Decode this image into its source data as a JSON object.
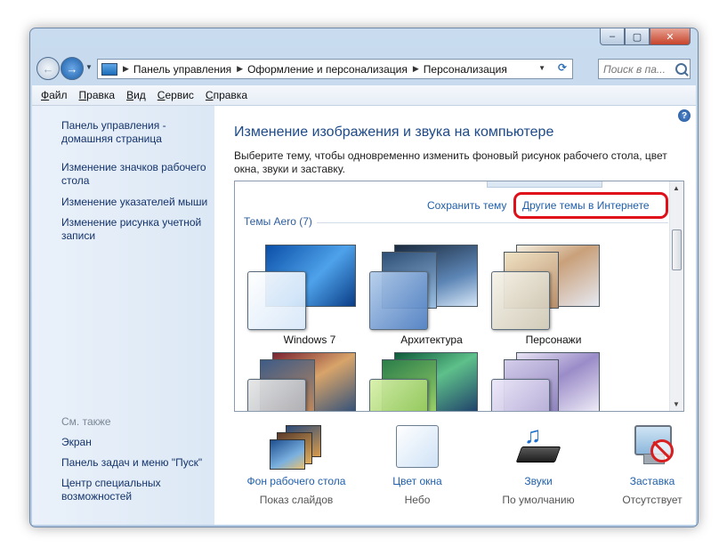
{
  "toolbar": {
    "address": [
      "Панель управления",
      "Оформление и персонализация",
      "Персонализация"
    ],
    "search_placeholder": "Поиск в па..."
  },
  "menu": {
    "items": [
      {
        "first": "Ф",
        "rest": "айл"
      },
      {
        "first": "П",
        "rest": "равка"
      },
      {
        "first": "В",
        "rest": "ид"
      },
      {
        "first": "С",
        "rest": "ервис"
      },
      {
        "first": "С",
        "rest": "правка"
      }
    ]
  },
  "sidebar": {
    "links": [
      "Панель управления - домашняя страница",
      "Изменение значков рабочего стола",
      "Изменение указателей мыши",
      "Изменение рисунка учетной записи"
    ],
    "see_also_label": "См. также",
    "see_also": [
      "Экран",
      "Панель задач и меню \"Пуск\"",
      "Центр специальных возможностей"
    ]
  },
  "main": {
    "title": "Изменение изображения и звука на компьютере",
    "description": "Выберите тему, чтобы одновременно изменить фоновый рисунок рабочего стола, цвет окна, звуки и заставку.",
    "save_theme": "Сохранить тему",
    "online_themes": "Другие темы в Интернете",
    "group_header": "Темы Aero (7)",
    "themes": [
      "Windows 7",
      "Архитектура",
      "Персонажи",
      "",
      "",
      ""
    ]
  },
  "bottom": [
    {
      "label": "Фон рабочего стола",
      "sub": "Показ слайдов"
    },
    {
      "label": "Цвет окна",
      "sub": "Небо"
    },
    {
      "label": "Звуки",
      "sub": "По умолчанию"
    },
    {
      "label": "Заставка",
      "sub": "Отсутствует"
    }
  ],
  "colors": {
    "link": "#1f5fab",
    "title": "#1e4a8a",
    "highlight": "#e0101a",
    "sidebar_link": "#15346b"
  }
}
